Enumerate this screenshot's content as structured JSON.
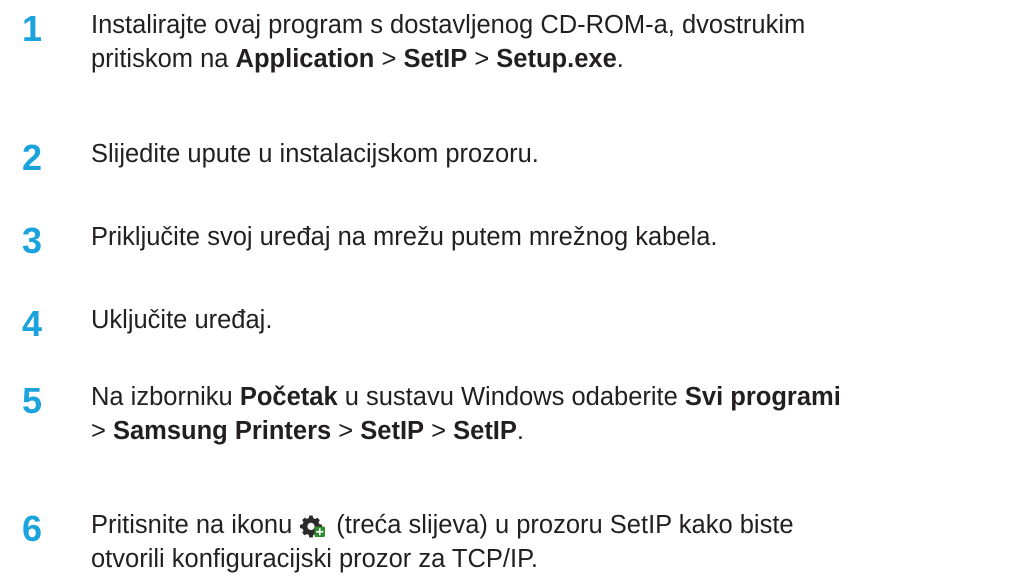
{
  "steps": [
    {
      "number": "1",
      "lines": [
        [
          {
            "t": "Instalirajte ovaj program s dostavljenog CD-ROM-a, dvostrukim"
          }
        ],
        [
          {
            "t": "pritiskom na "
          },
          {
            "t": "Application",
            "b": true
          },
          {
            "t": " > "
          },
          {
            "t": "SetIP",
            "b": true
          },
          {
            "t": " > "
          },
          {
            "t": "Setup.exe",
            "b": true
          },
          {
            "t": "."
          }
        ]
      ]
    },
    {
      "number": "2",
      "lines": [
        [
          {
            "t": "Slijedite upute u instalacijskom prozoru."
          }
        ]
      ]
    },
    {
      "number": "3",
      "lines": [
        [
          {
            "t": "Priključite svoj uređaj na mrežu putem mrežnog kabela."
          }
        ]
      ]
    },
    {
      "number": "4",
      "lines": [
        [
          {
            "t": "Uključite uređaj."
          }
        ]
      ]
    },
    {
      "number": "5",
      "lines": [
        [
          {
            "t": "Na izborniku "
          },
          {
            "t": "Početak",
            "b": true
          },
          {
            "t": " u sustavu Windows odaberite "
          },
          {
            "t": "Svi programi",
            "b": true
          }
        ],
        [
          {
            "t": "> "
          },
          {
            "t": "Samsung Printers",
            "b": true
          },
          {
            "t": " > "
          },
          {
            "t": "SetIP",
            "b": true
          },
          {
            "t": " > "
          },
          {
            "t": "SetIP",
            "b": true
          },
          {
            "t": "."
          }
        ]
      ]
    },
    {
      "number": "6",
      "lines": [
        [
          {
            "t": "Pritisnite na ikonu"
          },
          {
            "icon": "tcpip-settings-gear-icon"
          },
          {
            "t": "(treća slijeva) u prozoru SetIP kako biste"
          }
        ],
        [
          {
            "t": "otvorili konfiguracijski prozor za TCP/IP."
          }
        ]
      ]
    }
  ],
  "colors": {
    "step_number": "#1aa3dd",
    "text": "#231f20"
  }
}
